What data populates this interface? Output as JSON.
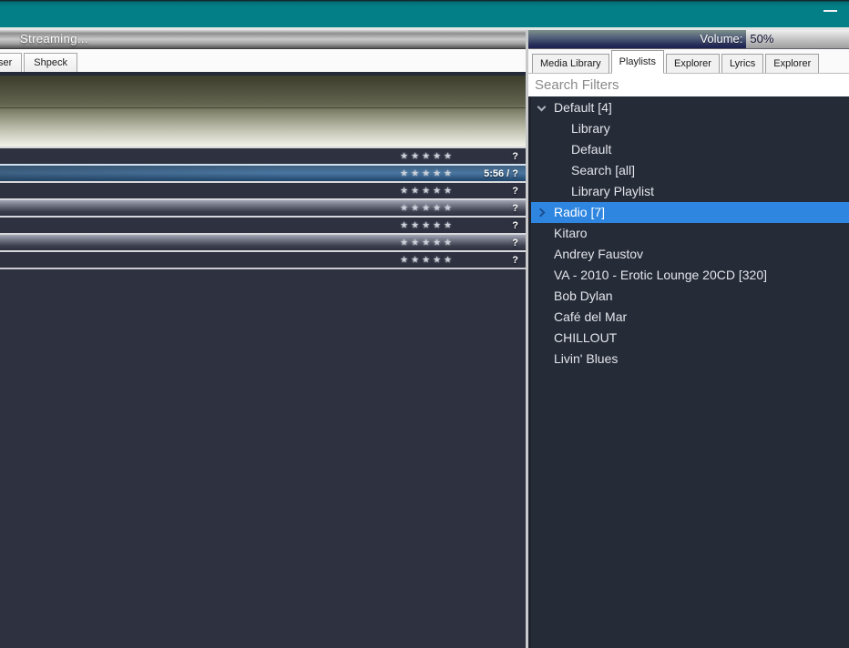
{
  "window": {
    "titlebar_color": "#038087",
    "controls": [
      {
        "icon": "minimize-icon"
      }
    ]
  },
  "left_panel": {
    "status_bar": {
      "text": "Streaming..."
    },
    "tabs": [
      {
        "label": "ser",
        "clipped": true
      },
      {
        "label": "Shpeck"
      }
    ],
    "playlist": {
      "rows": [
        {
          "stars": "★★★★★",
          "duration": "?"
        },
        {
          "stars": "★★★★★",
          "duration": "5:56 / ?",
          "selected": true
        },
        {
          "stars": "★★★★★",
          "duration": "?"
        },
        {
          "stars": "★★★★★",
          "duration": "?",
          "striped": true
        },
        {
          "stars": "★★★★★",
          "duration": "?"
        },
        {
          "stars": "★★★★★",
          "duration": "?",
          "striped": true
        },
        {
          "stars": "★★★★★",
          "duration": "?"
        }
      ]
    }
  },
  "right_panel": {
    "volume_bar": {
      "label": "Volume:",
      "value": "50%",
      "fill_percent": 68
    },
    "tabs": [
      {
        "label": "Media Library"
      },
      {
        "label": "Playlists",
        "active": true
      },
      {
        "label": "Explorer"
      },
      {
        "label": "Lyrics"
      },
      {
        "label": "Explorer"
      }
    ],
    "search": {
      "placeholder": "Search Filters"
    },
    "tree": {
      "items": [
        {
          "label": "Default [4]",
          "expander_down": true,
          "expander_icon": "chevron-down-icon"
        },
        {
          "label": "Library",
          "indent": true
        },
        {
          "label": "Default",
          "indent": true
        },
        {
          "label": "Search [all]",
          "indent": true
        },
        {
          "label": "Library Playlist",
          "indent": true
        },
        {
          "label": "Radio [7]",
          "expander_right": true,
          "expander_icon": "chevron-right-icon",
          "selected": true
        },
        {
          "label": "Kitaro"
        },
        {
          "label": "Andrey Faustov"
        },
        {
          "label": "VA - 2010 - Erotic Lounge 20CD [320]"
        },
        {
          "label": "Bob Dylan"
        },
        {
          "label": "Café del Mar"
        },
        {
          "label": "CHILLOUT"
        },
        {
          "label": "Livin' Blues"
        }
      ]
    }
  },
  "colors": {
    "titlebar_teal": "#038087",
    "selection_blue": "#2e86e0",
    "playlist_selection_blue": "#4a76a0",
    "panel_dark": "#2d3140",
    "volume_fill_navy": "#1b2150"
  }
}
